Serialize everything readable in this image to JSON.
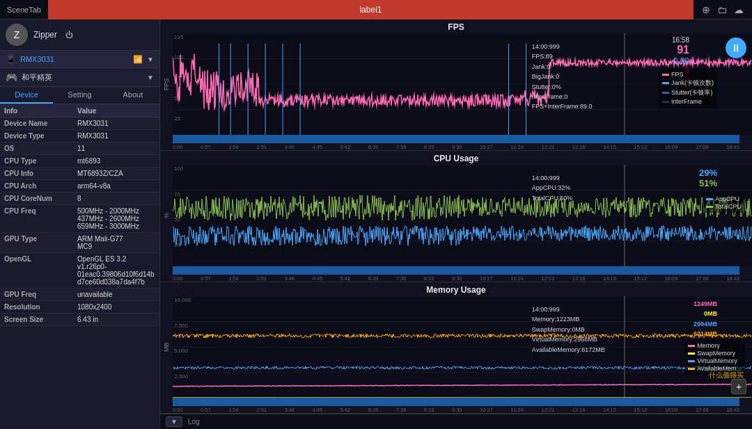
{
  "topbar": {
    "scene_tab": "SceneTab",
    "center_label": "label1",
    "icons": [
      "location-icon",
      "folder-icon",
      "cloud-icon"
    ]
  },
  "sidebar": {
    "user": {
      "name": "Zipper",
      "avatar_char": "Z"
    },
    "device": {
      "name": "RMX3031",
      "icon": "📱"
    },
    "app": {
      "name": "和平精英",
      "icon": "🎮"
    },
    "tabs": [
      "Device",
      "Setting",
      "About"
    ],
    "active_tab": "Device",
    "info_header": {
      "label": "Info",
      "value": "Value"
    },
    "info_rows": [
      {
        "label": "Device Name",
        "value": "RMX3031"
      },
      {
        "label": "Device Type",
        "value": "RMX3031"
      },
      {
        "label": "OS",
        "value": "11"
      },
      {
        "label": "CPU Type",
        "value": "mt6893"
      },
      {
        "label": "CPU Info",
        "value": "MT6893Z/CZA"
      },
      {
        "label": "CPU Arch",
        "value": "arm64-v8a"
      },
      {
        "label": "CPU CoreNum",
        "value": "8"
      },
      {
        "label": "CPU Freq",
        "value": "500MHz - 2000MHz\n437MHz - 2600MHz\n659MHz - 3000MHz"
      },
      {
        "label": "GPU Type",
        "value": "ARM Mali-G77\nMC9"
      },
      {
        "label": "OpenGL",
        "value": "OpenGL ES 3.2 v1.r26p0-01eac0.39806d10f6d14bd7ce60d038a7da4f7b"
      },
      {
        "label": "GPU Freq",
        "value": "unavailable"
      },
      {
        "label": "Resolution",
        "value": "1080x2400"
      },
      {
        "label": "Screen Size",
        "value": "6.43 in"
      }
    ]
  },
  "charts": {
    "fps": {
      "title": "FPS",
      "y_label": "FPS",
      "y_ticks": [
        "125",
        "100",
        "75",
        "50",
        "25",
        "0"
      ],
      "x_ticks": [
        "0:00",
        "0:57",
        "1:54",
        "2:51",
        "3:48",
        "4:45",
        "5:42",
        "6:39",
        "7:36",
        "8:33",
        "9:30",
        "10:27",
        "11:24",
        "12:21",
        "13:18",
        "14:15",
        "15:12",
        "16:09",
        "17:06",
        "18:43"
      ],
      "tooltip": {
        "time": "14:00:999",
        "fps": "FPS:89",
        "jank": "Jank:0",
        "bigjank": "BigJank:0",
        "stutter": "Stutter:0%",
        "interframe": "InterFrame:0",
        "fps_interframe": "FPS+InterFrame:89.0"
      },
      "counter": {
        "time": "16:58",
        "fps": "91",
        "sub": "0.00",
        "sub2": "0"
      },
      "legend": [
        {
          "label": "FPS",
          "color": "#ff69b4"
        },
        {
          "label": "Jank(卡顿次数)",
          "color": "#4af"
        },
        {
          "label": "Stutter(卡顿率)",
          "color": "#4af"
        },
        {
          "label": "InterFrame",
          "color": "#4af"
        }
      ]
    },
    "cpu": {
      "title": "CPU Usage",
      "y_label": "%",
      "y_ticks": [
        "100",
        "75",
        "50",
        "25",
        "0"
      ],
      "x_ticks": [
        "0:00",
        "0:57",
        "1:54",
        "2:51",
        "3:48",
        "4:45",
        "5:42",
        "6:39",
        "7:36",
        "8:33",
        "9:30",
        "10:27",
        "11:24",
        "12:21",
        "13:18",
        "14:15",
        "15:12",
        "16:09",
        "17:06",
        "18:43"
      ],
      "tooltip": {
        "time": "14:00:999",
        "app_cpu": "AppCPU:32%",
        "total_cpu": "TotalCPU:50%"
      },
      "counter": {
        "app_pct": "29%",
        "total_pct": "51%"
      },
      "legend": [
        {
          "label": "AppCPU",
          "color": "#4af"
        },
        {
          "label": "TotalCPU",
          "color": "#8a4"
        }
      ]
    },
    "memory": {
      "title": "Memory Usage",
      "y_label": "MB",
      "y_ticks": [
        "10,000",
        "7,500",
        "5,000",
        "2,500",
        "0"
      ],
      "x_ticks": [
        "0:00",
        "0:57",
        "1:54",
        "2:51",
        "3:48",
        "4:45",
        "5:42",
        "6:39",
        "7:36",
        "8:33",
        "9:30",
        "10:27",
        "11:24",
        "12:21",
        "13:18",
        "14:15",
        "15:12",
        "16:09",
        "17:06",
        "18:43"
      ],
      "tooltip": {
        "time": "14:00:999",
        "memory": "Memory:1223MB",
        "swap": "SwapMemory:0MB",
        "virtual": "VirtualMemory:2968MB",
        "available": "AvailableMemory:6172MB"
      },
      "counter": {
        "memory": "1249MB",
        "swap": "0MB",
        "virtual": "2994MB",
        "available": "6214MB"
      },
      "legend": [
        {
          "label": "Memory",
          "color": "#ff69b4"
        },
        {
          "label": "SwapMemory",
          "color": "#ff0"
        },
        {
          "label": "VirtualMemory",
          "color": "#4af"
        },
        {
          "label": "AvailableMem...",
          "color": "#fa0"
        }
      ]
    }
  },
  "bottom": {
    "btn_label": "▼",
    "log_label": "Log",
    "plus_label": "+"
  },
  "watermark": "什么值得买"
}
